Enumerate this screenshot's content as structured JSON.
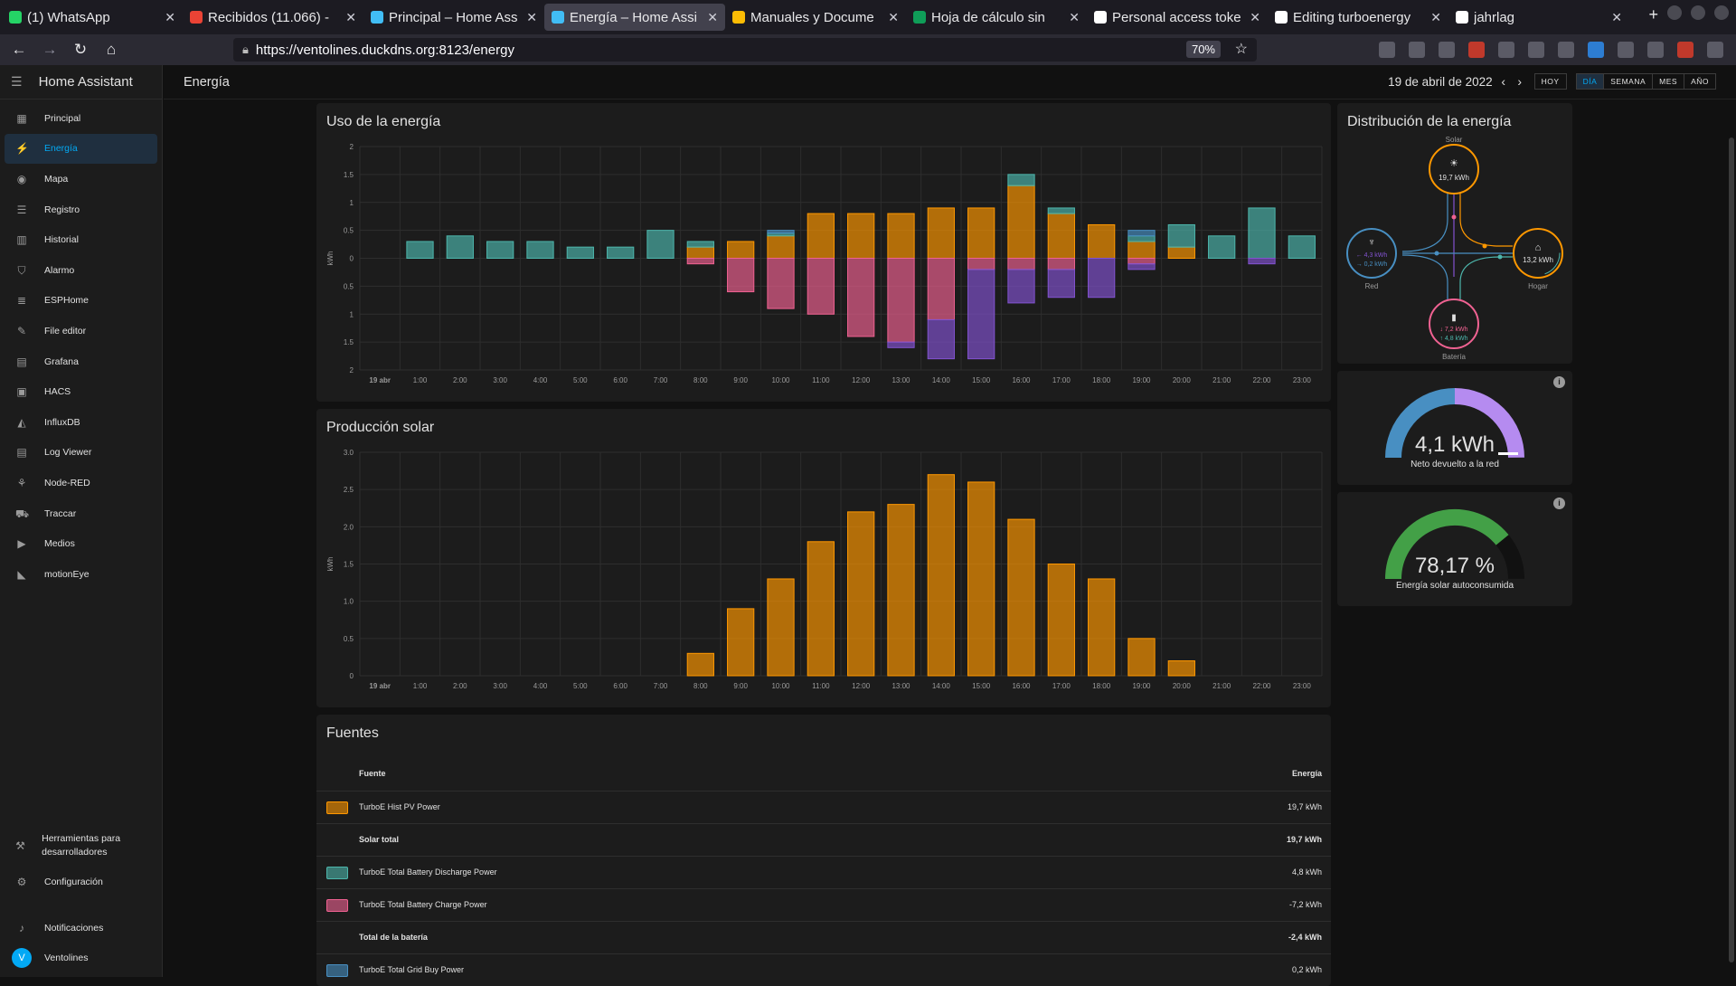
{
  "browser": {
    "tabs": [
      {
        "label": "(1) WhatsApp",
        "color": "#25d366",
        "active": false
      },
      {
        "label": "Recibidos (11.066) -",
        "color": "#ea4335",
        "active": false
      },
      {
        "label": "Principal – Home Ass",
        "color": "#41bdf5",
        "active": false
      },
      {
        "label": "Energía – Home Assi",
        "color": "#41bdf5",
        "active": true
      },
      {
        "label": "Manuales y Docume",
        "color": "#fbbc04",
        "active": false
      },
      {
        "label": "Hoja de cálculo sin",
        "color": "#0f9d58",
        "active": false
      },
      {
        "label": "Personal access toke",
        "color": "#ffffff",
        "active": false
      },
      {
        "label": "Editing turboenergy",
        "color": "#ffffff",
        "active": false
      },
      {
        "label": "jahrlag",
        "color": "#ffffff",
        "active": false
      }
    ],
    "url": "https://ventolines.duckdns.org:8123/energy",
    "zoom": "70%"
  },
  "sidebar": {
    "title": "Home Assistant",
    "items": [
      {
        "label": "Principal",
        "icon": "dashboard-icon",
        "glyph": "▦"
      },
      {
        "label": "Energía",
        "icon": "lightning-icon",
        "glyph": "⚡",
        "active": true
      },
      {
        "label": "Mapa",
        "icon": "map-icon",
        "glyph": "◉"
      },
      {
        "label": "Registro",
        "icon": "list-icon",
        "glyph": "☰"
      },
      {
        "label": "Historial",
        "icon": "chart-icon",
        "glyph": "▥"
      },
      {
        "label": "Alarmo",
        "icon": "shield-icon",
        "glyph": "⛉"
      },
      {
        "label": "ESPHome",
        "icon": "esphome-icon",
        "glyph": "≣"
      },
      {
        "label": "File editor",
        "icon": "wrench-icon",
        "glyph": "✎"
      },
      {
        "label": "Grafana",
        "icon": "grafana-icon",
        "glyph": "▤"
      },
      {
        "label": "HACS",
        "icon": "hacs-icon",
        "glyph": "▣"
      },
      {
        "label": "InfluxDB",
        "icon": "area-chart-icon",
        "glyph": "◭"
      },
      {
        "label": "Log Viewer",
        "icon": "log-icon",
        "glyph": "▤"
      },
      {
        "label": "Node-RED",
        "icon": "sitemap-icon",
        "glyph": "⚘"
      },
      {
        "label": "Traccar",
        "icon": "car-icon",
        "glyph": "⛟"
      },
      {
        "label": "Medios",
        "icon": "media-icon",
        "glyph": "▶"
      },
      {
        "label": "motionEye",
        "icon": "camera-icon",
        "glyph": "◣"
      }
    ],
    "bottom": [
      {
        "label": "Herramientas para desarrolladores",
        "icon": "hammer-icon",
        "glyph": "⚒"
      },
      {
        "label": "Configuración",
        "icon": "cog-icon",
        "glyph": "⚙"
      },
      {
        "label": "Notificaciones",
        "icon": "bell-icon",
        "glyph": "♪"
      }
    ],
    "user": {
      "label": "Ventolines",
      "initial": "V"
    }
  },
  "header": {
    "title": "Energía",
    "date": "19 de abril de 2022",
    "today": "HOY",
    "periods": [
      "DÍA",
      "SEMANA",
      "MES",
      "AÑO"
    ],
    "selected_period": "DÍA"
  },
  "usage_card": {
    "title": "Uso de la energía",
    "y_unit": "kWh"
  },
  "solar_card": {
    "title": "Producción solar",
    "y_unit": "kWh"
  },
  "distribution": {
    "title": "Distribución de la energía",
    "solar_label": "Solar",
    "solar_value": "19,7 kWh",
    "grid_label": "Red",
    "grid_in": "← 4,3 kWh",
    "grid_out": "→ 0,2 kWh",
    "home_label": "Hogar",
    "home_value": "13,2 kWh",
    "battery_label": "Batería",
    "battery_in": "↓ 7,2 kWh",
    "battery_out": "↑ 4,8 kWh",
    "colors": {
      "solar": "#ff9800",
      "grid": "#488fc2",
      "return": "#8353d1",
      "home": "#ff9800",
      "battery": "#f06292",
      "battery_out": "#4db6ac"
    }
  },
  "gauge_grid": {
    "value": "4,1 kWh",
    "label": "Neto devuelto a la red",
    "fraction": 0.52
  },
  "gauge_solar": {
    "value": "78,17 %",
    "label": "Energía solar autoconsumida",
    "fraction": 0.7817
  },
  "sources": {
    "title": "Fuentes",
    "col_source": "Fuente",
    "col_energy": "Energía",
    "rows": [
      {
        "name": "TurboE Hist PV Power",
        "value": "19,7 kWh",
        "color": "#ff9800",
        "bold": false,
        "swatch": true
      },
      {
        "name": "Solar total",
        "value": "19,7 kWh",
        "bold": true,
        "swatch": false
      },
      {
        "name": "TurboE Total Battery Discharge Power",
        "value": "4,8 kWh",
        "color": "#4db6ac",
        "bold": false,
        "swatch": true
      },
      {
        "name": "TurboE Total Battery Charge Power",
        "value": "-7,2 kWh",
        "color": "#f06292",
        "bold": false,
        "swatch": true
      },
      {
        "name": "Total de la batería",
        "value": "-2,4 kWh",
        "bold": true,
        "swatch": false
      },
      {
        "name": "TurboE Total Grid Buy Power",
        "value": "0,2 kWh",
        "color": "#488fc2",
        "bold": false,
        "swatch": true
      }
    ]
  },
  "chart_data": [
    {
      "type": "bar",
      "title": "Uso de la energía",
      "ylabel": "kWh",
      "ylim": [
        -2,
        2
      ],
      "y_ticks": [
        2,
        1.5,
        1,
        0.5,
        0,
        0.5,
        1,
        1.5,
        2
      ],
      "categories": [
        "19 abr",
        "1:00",
        "2:00",
        "3:00",
        "4:00",
        "5:00",
        "6:00",
        "7:00",
        "8:00",
        "9:00",
        "10:00",
        "11:00",
        "12:00",
        "13:00",
        "14:00",
        "15:00",
        "16:00",
        "17:00",
        "18:00",
        "19:00",
        "20:00",
        "21:00",
        "22:00",
        "23:00"
      ],
      "series": [
        {
          "color": "#ff9800",
          "values": [
            0,
            0,
            0,
            0,
            0,
            0,
            0,
            0,
            0.2,
            0.3,
            0.4,
            0.8,
            0.8,
            0.8,
            0.9,
            0.9,
            1.3,
            0.8,
            0.6,
            0.3,
            0.2,
            0,
            0,
            0
          ]
        },
        {
          "color": "#4db6ac",
          "values": [
            0,
            0.3,
            0.4,
            0.3,
            0.3,
            0.2,
            0.2,
            0.5,
            0.1,
            0,
            0.05,
            0,
            0,
            0,
            0,
            0,
            0.2,
            0.1,
            0,
            0.1,
            0.4,
            0.4,
            0.9,
            0.4
          ]
        },
        {
          "color": "#488fc2",
          "values": [
            0,
            0,
            0,
            0,
            0,
            0,
            0,
            0,
            0,
            0,
            0.05,
            0,
            0,
            0,
            0,
            0,
            0,
            0,
            0,
            0.1,
            0,
            0,
            0,
            0
          ]
        },
        {
          "color": "#f06292",
          "values": [
            0,
            0,
            0,
            0,
            0,
            0,
            0,
            0,
            -0.1,
            -0.6,
            -0.9,
            -1.0,
            -1.4,
            -1.5,
            -1.1,
            -0.2,
            -0.2,
            -0.2,
            0,
            -0.1,
            0,
            0,
            0,
            0
          ]
        },
        {
          "color": "#8353d1",
          "values": [
            0,
            0,
            0,
            0,
            0,
            0,
            0,
            0,
            0,
            0,
            0,
            0,
            0,
            -0.1,
            -0.7,
            -1.6,
            -0.6,
            -0.5,
            -0.7,
            -0.1,
            0,
            0,
            -0.1,
            0
          ]
        }
      ]
    },
    {
      "type": "bar",
      "title": "Producción solar",
      "ylabel": "kWh",
      "ylim": [
        0,
        3
      ],
      "y_ticks": [
        "3.0",
        "2.5",
        "2.0",
        "1.5",
        "1.0",
        "0.5",
        "0"
      ],
      "categories": [
        "19 abr",
        "1:00",
        "2:00",
        "3:00",
        "4:00",
        "5:00",
        "6:00",
        "7:00",
        "8:00",
        "9:00",
        "10:00",
        "11:00",
        "12:00",
        "13:00",
        "14:00",
        "15:00",
        "16:00",
        "17:00",
        "18:00",
        "19:00",
        "20:00",
        "21:00",
        "22:00",
        "23:00"
      ],
      "series": [
        {
          "color": "#ff9800",
          "values": [
            0,
            0,
            0,
            0,
            0,
            0,
            0,
            0,
            0.3,
            0.9,
            1.3,
            1.8,
            2.2,
            2.3,
            2.7,
            2.6,
            2.1,
            1.5,
            1.3,
            0.5,
            0.2,
            0,
            0,
            0
          ]
        }
      ]
    }
  ]
}
